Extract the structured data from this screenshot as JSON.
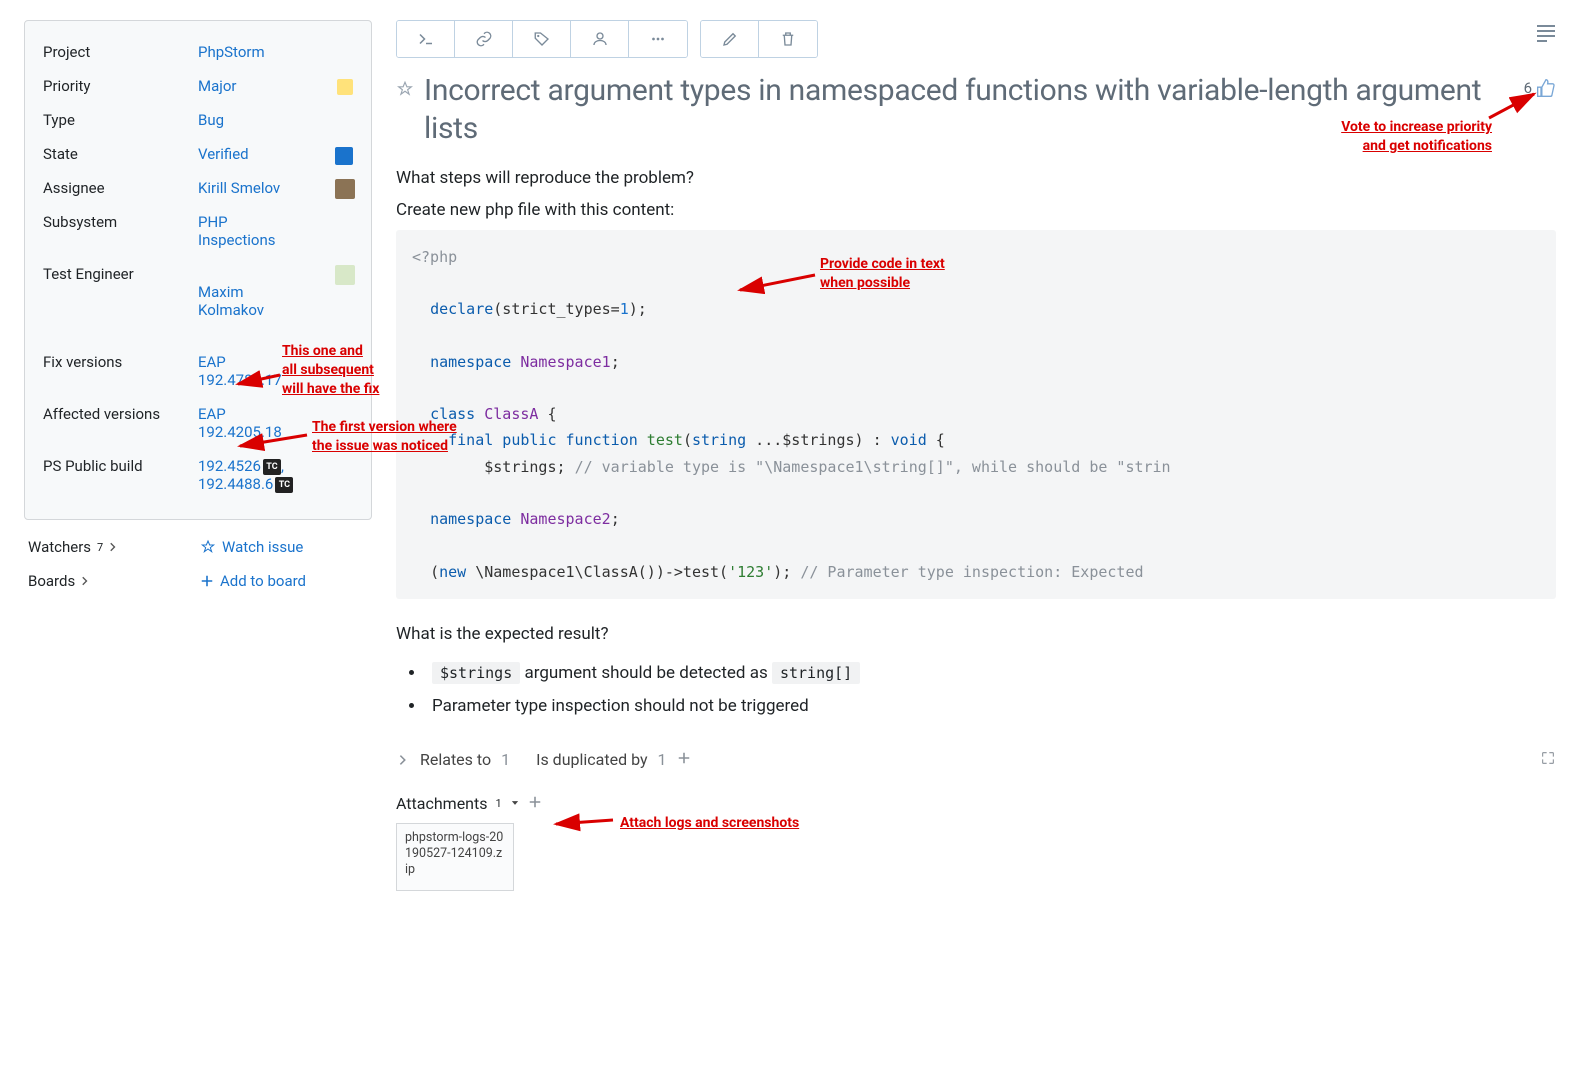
{
  "sidebar": {
    "fields": {
      "project": {
        "label": "Project",
        "value": "PhpStorm"
      },
      "priority": {
        "label": "Priority",
        "value": "Major"
      },
      "type": {
        "label": "Type",
        "value": "Bug"
      },
      "state": {
        "label": "State",
        "value": "Verified"
      },
      "assignee": {
        "label": "Assignee",
        "value": "Kirill Smelov"
      },
      "subsystem": {
        "label": "Subsystem",
        "value": "PHP\nInspections"
      },
      "test_engineer": {
        "label": "Test Engineer",
        "value": "Maxim\nKolmakov"
      },
      "fix_versions": {
        "label": "Fix versions",
        "value": "EAP\n192.4787.17"
      },
      "affected_versions": {
        "label": "Affected versions",
        "value": "EAP\n192.4205.18"
      },
      "ps_public_build": {
        "label": "PS Public build",
        "value1": "192.4526",
        "value2": "192.4488.6",
        "tc": "TC"
      }
    },
    "watchers": {
      "label": "Watchers",
      "count": "7",
      "action": "Watch issue"
    },
    "boards": {
      "label": "Boards",
      "action": "Add to board"
    }
  },
  "main": {
    "title": "Incorrect argument types in namespaced functions with variable-length argument lists",
    "votes": "6",
    "reproduce_q": "What steps will reproduce the problem?",
    "reproduce_instr": "Create new php file with this content:",
    "expected_q": "What is the expected result?",
    "expected_1a": "$strings",
    "expected_1b": " argument should be detected as ",
    "expected_1c": "string[]",
    "expected_2": "Parameter type inspection should not be triggered",
    "links": {
      "relates_label": "Relates to",
      "relates_count": "1",
      "dup_label": "Is duplicated by",
      "dup_count": "1"
    },
    "attachments": {
      "label": "Attachments",
      "count": "1",
      "file": "phpstorm-logs-20190527-124109.zip"
    }
  },
  "code": {
    "l1": "<?php",
    "l2a": "declare",
    "l2b": "(strict_types=",
    "l2c": "1",
    "l2d": ");",
    "l3a": "namespace",
    "l3b": " Namespace1",
    "l3c": ";",
    "l4a": "class",
    "l4b": " ClassA ",
    "l4c": "{",
    "l5a": "final public function",
    "l5b": " test",
    "l5c": "(",
    "l5d": "string",
    "l5e": " ...$strings) : ",
    "l5f": "void",
    "l5g": " {",
    "l6a": "        $strings; ",
    "l6b": "// variable type is \"\\Namespace1\\string[]\", while should be \"strin",
    "l7a": "namespace",
    "l7b": " Namespace2",
    "l7c": ";",
    "l8a": "(",
    "l8b": "new",
    "l8c": " \\Namespace1\\ClassA())->test(",
    "l8d": "'123'",
    "l8e": "); ",
    "l8f": "// Parameter type inspection: Expected "
  },
  "annotations": {
    "vote": "Vote to increase priority\nand get notifications",
    "code": "Provide code in text\nwhen possible",
    "fix": "This one and\nall subsequent\nwill have the fix",
    "affected": "The first version where\nthe issue was noticed",
    "attach": "Attach logs and screenshots"
  }
}
